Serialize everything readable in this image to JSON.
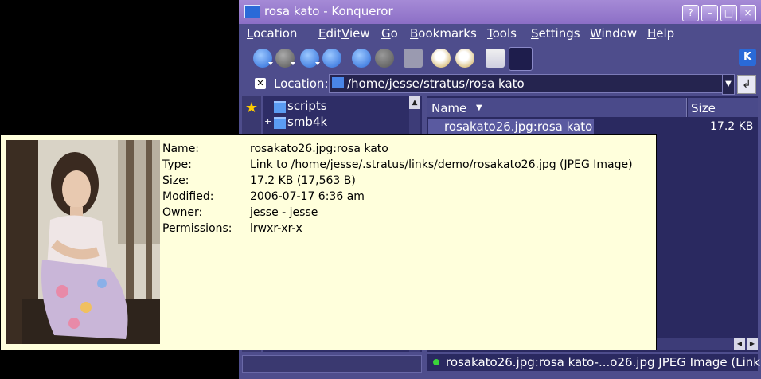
{
  "window": {
    "title": "rosa kato - Konqueror",
    "buttons": {
      "help": "?",
      "minimize": "–",
      "maximize": "□",
      "close": "×"
    }
  },
  "menubar": {
    "items": [
      {
        "label": "Location",
        "accel": "L"
      },
      {
        "label": "Edit",
        "accel": "E"
      },
      {
        "label": "View",
        "accel": "V"
      },
      {
        "label": "Go",
        "accel": "G"
      },
      {
        "label": "Bookmarks",
        "accel": "B"
      },
      {
        "label": "Tools",
        "accel": "T"
      },
      {
        "label": "Settings",
        "accel": "S"
      },
      {
        "label": "Window",
        "accel": "W"
      },
      {
        "label": "Help",
        "accel": "H"
      }
    ]
  },
  "toolbar": {
    "icons": [
      "back-icon",
      "forward-icon",
      "up-icon",
      "home-icon",
      "reload-icon",
      "stop-icon",
      "print-icon",
      "zoom-in-icon",
      "zoom-out-icon",
      "icon-view-icon",
      "detail-view-icon",
      "kde-logo-icon"
    ]
  },
  "location": {
    "label": "Location:",
    "value": "/home/jesse/stratus/rosa kato"
  },
  "sidebar": {
    "tree": [
      {
        "label": "scripts",
        "expander": ""
      },
      {
        "label": "smb4k",
        "expander": "+"
      }
    ]
  },
  "filelist": {
    "columns": {
      "name": "Name",
      "size": "Size"
    },
    "rows": [
      {
        "name": "rosakato26.jpg:rosa kato",
        "size": "17.2 KB"
      }
    ]
  },
  "statusbar": {
    "text": "rosakato26.jpg:rosa kato-...o26.jpg  JPEG Image (Link)"
  },
  "tooltip": {
    "fields": [
      {
        "label": "Name:",
        "value": "rosakato26.jpg:rosa kato"
      },
      {
        "label": "Type:",
        "value": "Link to /home/jesse/.stratus/links/demo/rosakato26.jpg (JPEG Image)"
      },
      {
        "label": "Size:",
        "value": "17.2 KB (17,563 B)"
      },
      {
        "label": "Modified:",
        "value": "2006-07-17 6:36 am"
      },
      {
        "label": "Owner:",
        "value": "jesse - jesse"
      },
      {
        "label": "Permissions:",
        "value": "lrwxr-xr-x"
      }
    ]
  },
  "colors": {
    "accent": "#4e4d8c",
    "titlebar": "#9a7fd0",
    "tooltip_bg": "#ffffdc"
  }
}
